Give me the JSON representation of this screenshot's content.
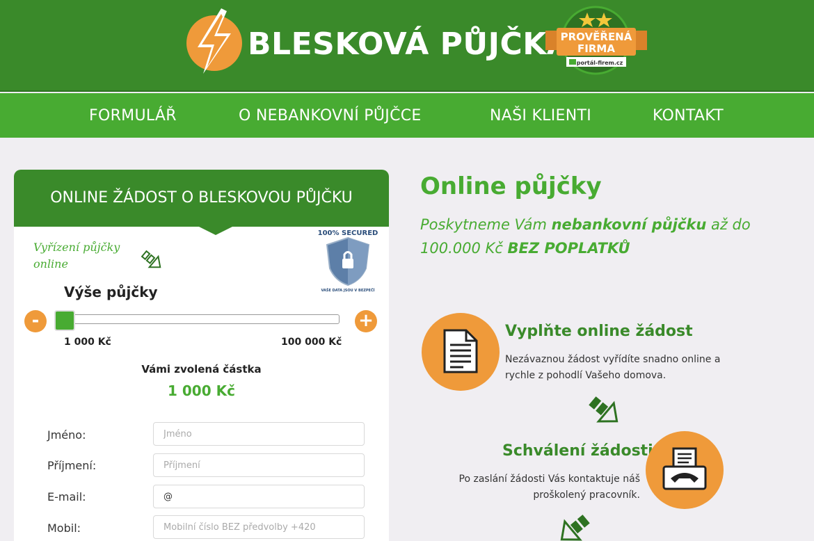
{
  "header": {
    "brand": "BLESKOVÁ PŮJČKA",
    "badge_line1": "PROVĚŘENÁ",
    "badge_line2": "FIRMA",
    "badge_small": "portál-firem.cz",
    "colors": {
      "dark_green": "#3a8a2a",
      "light_green": "#48ab32",
      "orange": "#ef9a3a"
    },
    "logo_icon": "lightning-bolt-icon"
  },
  "nav": {
    "items": [
      {
        "label": "FORMULÁŘ"
      },
      {
        "label": "O NEBANKOVNÍ PŮJČCE"
      },
      {
        "label": "NAŠI KLIENTI"
      },
      {
        "label": "KONTAKT"
      }
    ]
  },
  "form": {
    "title": "ONLINE ŽÁDOST O BLESKOVOU PŮJČKU",
    "note": "Vyřízení půjčky online",
    "secured_top": "100% SECURED",
    "secured_bottom": "VAŠE DATA JSOU V BEZPEČÍ",
    "amount_label": "Výše půjčky",
    "minus": "-",
    "plus": "+",
    "slider": {
      "min": 1000,
      "max": 100000,
      "value": 1000
    },
    "range_min_label": "1 000 Kč",
    "range_max_label": "100 000 Kč",
    "chosen_label": "Vámi zvolená částka",
    "chosen_value": "1 000 Kč",
    "fields": [
      {
        "label": "Jméno:",
        "placeholder": "Jméno",
        "value": ""
      },
      {
        "label": "Příjmení:",
        "placeholder": "Příjmení",
        "value": ""
      },
      {
        "label": "E-mail:",
        "placeholder": "",
        "value": "@"
      },
      {
        "label": "Mobil:",
        "placeholder": "Mobilní číslo BEZ předvolby +420",
        "value": ""
      }
    ]
  },
  "main": {
    "title": "Online půjčky",
    "sub_1": "Poskytneme Vám ",
    "sub_bold_1": "nebankovní půjčku",
    "sub_2": " až do 100.000 Kč ",
    "sub_bold_2": "BEZ POPLATKŮ",
    "steps": [
      {
        "icon": "document-icon",
        "title": "Vyplňte online žádost",
        "text": "Nezávaznou žádost vyřídíte snadno online a rychle z pohodlí Vašeho domova."
      },
      {
        "icon": "fax-phone-icon",
        "title": "Schválení žádosti",
        "text": "Po zaslání žádosti Vás kontaktuje náš proškolený pracovník."
      }
    ]
  }
}
